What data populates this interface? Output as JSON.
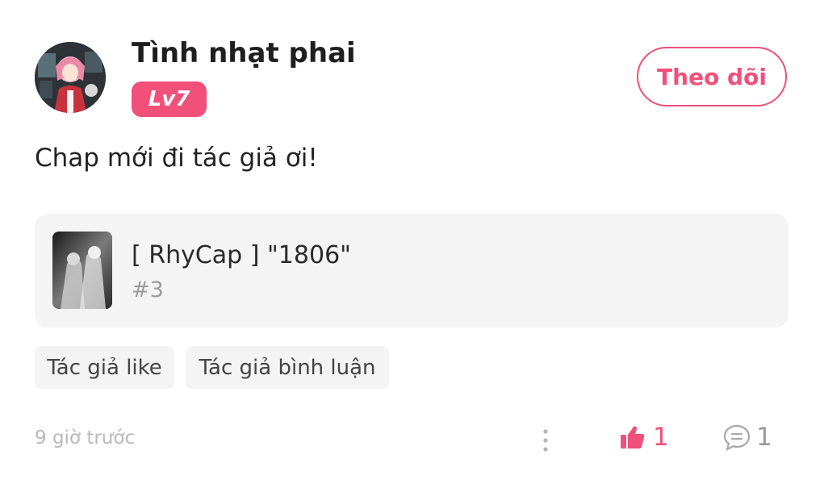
{
  "user": {
    "name": "Tình nhạt phai",
    "level": "Lv7",
    "follow_label": "Theo dõi"
  },
  "comment": {
    "text": "Chap mới đi tác giả ơi!"
  },
  "card": {
    "title": "[ RhyCap ] \"1806\"",
    "subtitle": "#3"
  },
  "tags": [
    "Tác giả like",
    "Tác giả bình luận"
  ],
  "footer": {
    "time": "9 giờ trước",
    "likes": "1",
    "comments": "1"
  },
  "colors": {
    "accent": "#f0507a",
    "muted": "#9a9a9a",
    "card_bg": "#f4f4f4"
  },
  "icons": [
    "more-vertical-icon",
    "thumbs-up-icon",
    "comment-bubble-icon"
  ]
}
